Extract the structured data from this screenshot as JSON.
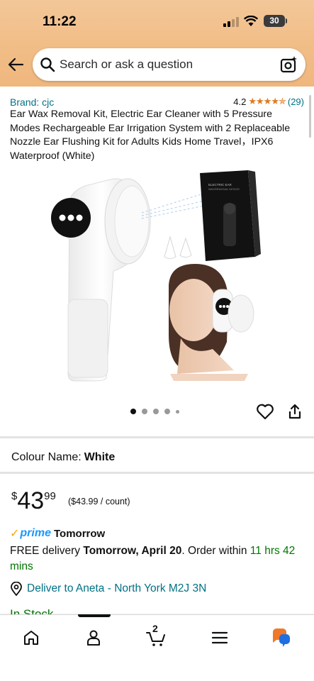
{
  "status_bar": {
    "time": "11:22",
    "battery": "30"
  },
  "search": {
    "placeholder": "Search or ask a question"
  },
  "product": {
    "brand": "Brand: cjc",
    "rating": "4.2",
    "stars": "★★★★✯",
    "review_count": "(29)",
    "title": "Ear Wax Removal Kit, Electric Ear Cleaner with 5 Pressure Modes Rechargeable Ear Irrigation System with 2 Replaceable Nozzle Ear Flushing Kit for Adults Kids Home Travel，IPX6 Waterproof (White)",
    "box_label_1": "ELECTRIC EAR",
    "box_label_2": "WAXREMOVAL DEVICE"
  },
  "carousel": {
    "total": 5,
    "active": 0
  },
  "colour": {
    "label": "Colour Name:",
    "value": "White"
  },
  "price": {
    "symbol": "$",
    "whole": "43",
    "fraction": "99",
    "per_unit": "($43.99 / count)"
  },
  "prime": {
    "check": "✓",
    "word": "prime",
    "when": "Tomorrow"
  },
  "delivery": {
    "prefix": "FREE delivery ",
    "date": "Tomorrow, April 20",
    "middle": ". Order within ",
    "countdown": "11 hrs 42 mins"
  },
  "deliver_to": "Deliver to Aneta - North York M2J 3N",
  "stock": "In Stock",
  "nav": {
    "cart_count": "2"
  },
  "colors": {
    "header": "#f1bd86",
    "link": "#007185",
    "star": "#de7921",
    "green": "#007600",
    "prime": "#1a98ff"
  }
}
